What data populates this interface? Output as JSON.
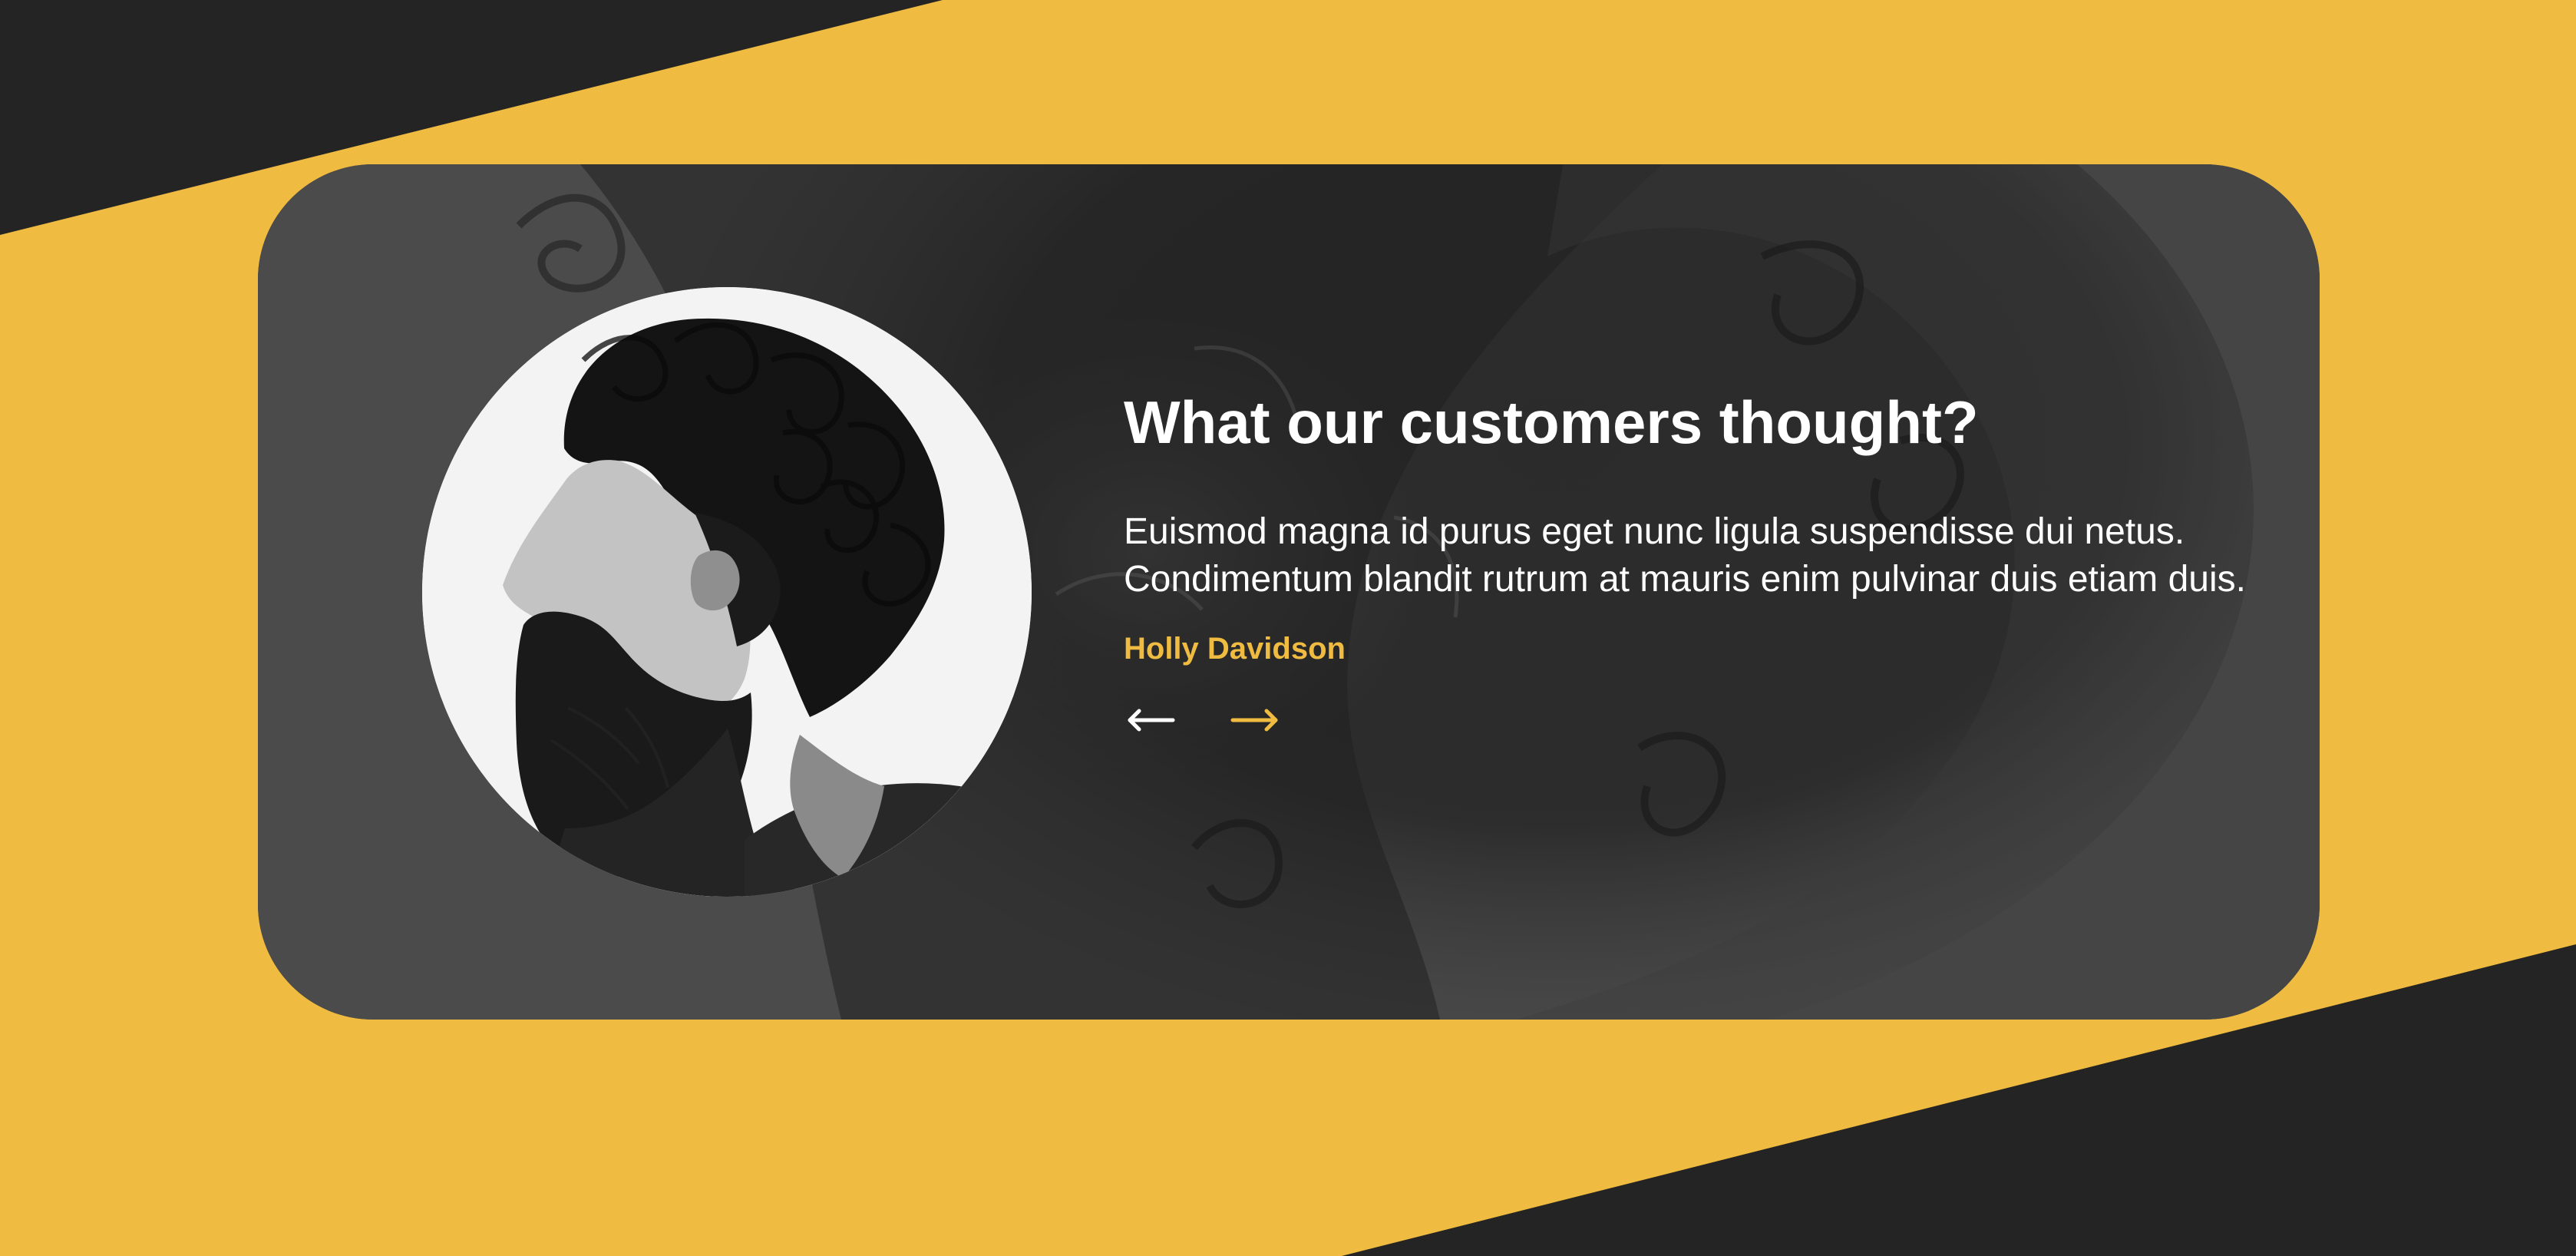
{
  "testimonial": {
    "heading": "What our customers thought?",
    "quote": "Euismod magna id purus eget nunc ligula suspendisse dui netus. Condimentum blandit rutrum at mauris enim pulvinar duis etiam duis.",
    "author": "Holly Davidson"
  },
  "navigation": {
    "prev_icon": "arrow-left-icon",
    "next_icon": "arrow-right-icon"
  },
  "colors": {
    "accent": "#efbb41",
    "dark": "#242424",
    "card": "#4b4b4b",
    "text": "#ffffff"
  }
}
